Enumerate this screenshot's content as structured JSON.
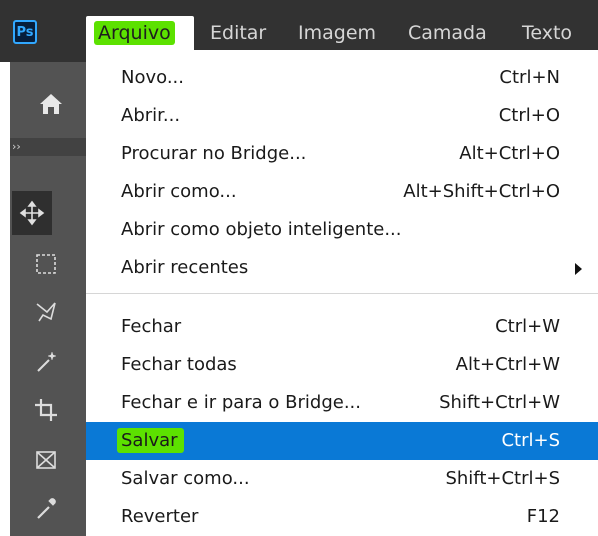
{
  "app": {
    "logo_text": "Ps"
  },
  "menubar": [
    {
      "label": "Arquivo",
      "active": true
    },
    {
      "label": "Editar"
    },
    {
      "label": "Imagem"
    },
    {
      "label": "Camada"
    },
    {
      "label": "Texto"
    }
  ],
  "toolbar": {
    "expand_label": "››",
    "tools": [
      "home-icon",
      "move-tool-icon",
      "marquee-tool-icon",
      "lasso-tool-icon",
      "magic-wand-tool-icon",
      "crop-tool-icon",
      "frame-tool-icon",
      "eyedropper-tool-icon"
    ]
  },
  "menu": {
    "groups": [
      [
        {
          "label": "Novo...",
          "shortcut": "Ctrl+N"
        },
        {
          "label": "Abrir...",
          "shortcut": "Ctrl+O"
        },
        {
          "label": "Procurar no Bridge...",
          "shortcut": "Alt+Ctrl+O"
        },
        {
          "label": "Abrir como...",
          "shortcut": "Alt+Shift+Ctrl+O"
        },
        {
          "label": "Abrir como objeto inteligente...",
          "shortcut": ""
        },
        {
          "label": "Abrir recentes",
          "shortcut": "",
          "submenu": true
        }
      ],
      [
        {
          "label": "Fechar",
          "shortcut": "Ctrl+W"
        },
        {
          "label": "Fechar todas",
          "shortcut": "Alt+Ctrl+W"
        },
        {
          "label": "Fechar e ir para o Bridge...",
          "shortcut": "Shift+Ctrl+W"
        },
        {
          "label": "Salvar",
          "shortcut": "Ctrl+S",
          "highlighted": true
        },
        {
          "label": "Salvar como...",
          "shortcut": "Shift+Ctrl+S"
        },
        {
          "label": "Reverter",
          "shortcut": "F12"
        }
      ]
    ]
  },
  "colors": {
    "menubar_bg": "#323232",
    "toolbar_bg": "#535353",
    "highlight_blue": "#0a79d6",
    "marker_green": "#5ce100"
  }
}
